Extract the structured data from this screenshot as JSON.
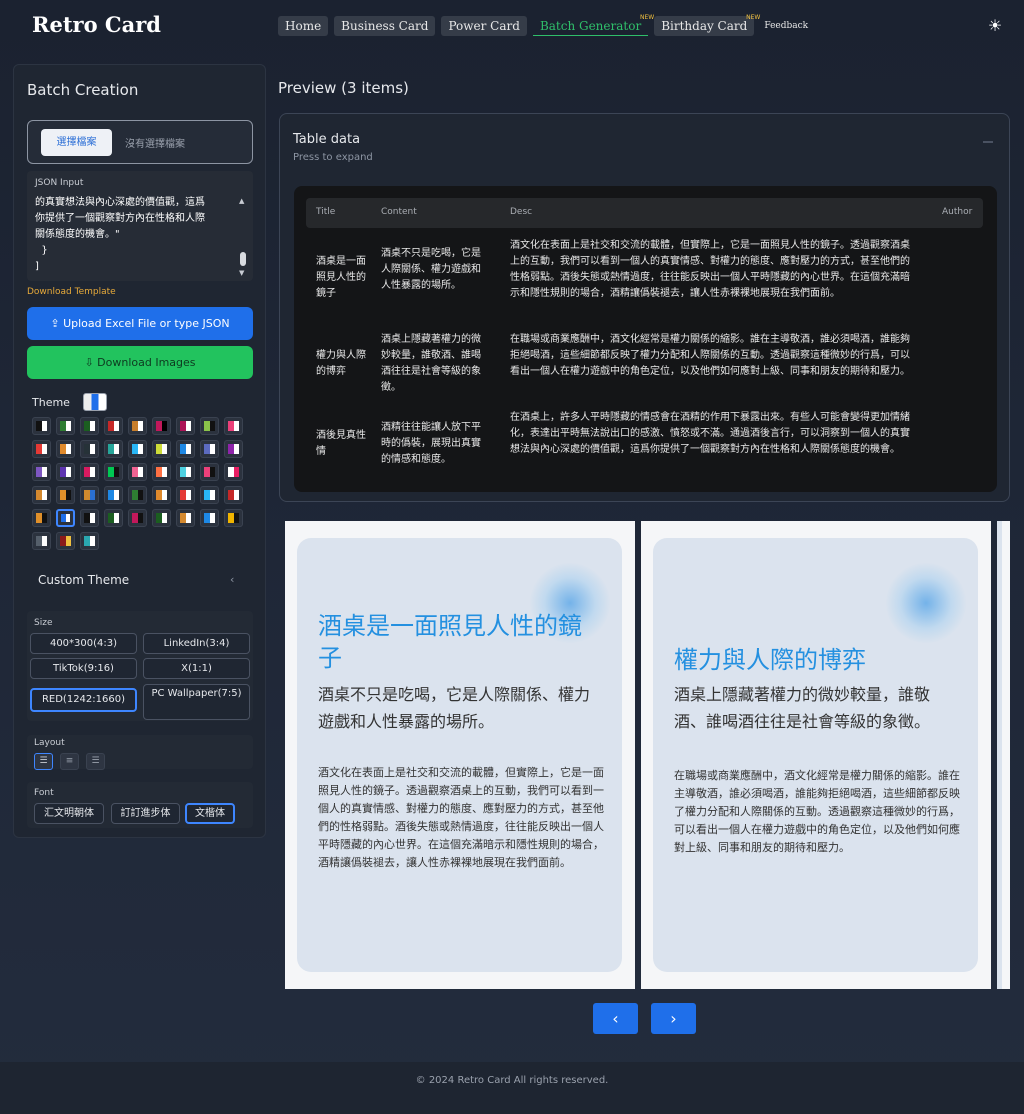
{
  "header": {
    "logo": "Retro Card",
    "nav": [
      {
        "label": "Home"
      },
      {
        "label": "Business Card"
      },
      {
        "label": "Power Card"
      },
      {
        "label": "Batch Generator",
        "badge": "NEW"
      },
      {
        "label": "Birthday Card",
        "badge": "NEW"
      },
      {
        "label": "Feedback"
      }
    ],
    "theme_toggle_icon": "sun-icon"
  },
  "sidebar": {
    "title": "Batch Creation",
    "file_button": "選擇檔案",
    "file_status": "沒有選擇檔案",
    "json_label": "JSON Input",
    "json_text": "的真實想法與內心深處的價值觀，這爲\n你提供了一個觀察對方內在性格和人際\n關係態度的機會。\"\n  }\n]",
    "download_template": "Download Template",
    "upload_button": "Upload Excel File or type JSON",
    "download_button": "Download Images",
    "theme_label": "Theme",
    "custom_theme": "Custom Theme",
    "size_label": "Size",
    "sizes": [
      "400*300(4:3)",
      "LinkedIn(3:4)",
      "TikTok(9:16)",
      "X(1:1)",
      "RED(1242:1660)",
      "PC Wallpaper(7:5)"
    ],
    "selected_size": "RED(1242:1660)",
    "layout_label": "Layout",
    "layouts": [
      "align-left-icon",
      "align-center-icon",
      "align-right-icon"
    ],
    "font_label": "Font",
    "fonts": [
      "汇文明朝体",
      "訂訂進步体",
      "文楷体"
    ],
    "selected_font": "文楷体",
    "theme_swatches": [
      [
        "#111111",
        "#ffffff"
      ],
      [
        "#2e7d32",
        "#ffffff"
      ],
      [
        "#1b5e20",
        "#ffffff"
      ],
      [
        "#c62828",
        "#ffffff"
      ],
      [
        "#c77d2a",
        "#ffffff"
      ],
      [
        "#c2185b",
        "#000000"
      ],
      [
        "#ad1457",
        "#ffffff"
      ],
      [
        "#8bc34a",
        "#111111"
      ],
      [
        "#ec407a",
        "#ffffff"
      ],
      [
        "#e53935",
        "#ffffff"
      ],
      [
        "#e08a2c",
        "#ffffff"
      ],
      [
        "#263238",
        "#ffffff"
      ],
      [
        "#26a69a",
        "#ffffff"
      ],
      [
        "#29b6f6",
        "#ffffff"
      ],
      [
        "#cddc39",
        "#ffffff"
      ],
      [
        "#1e88e5",
        "#ffffff"
      ],
      [
        "#5c6bc0",
        "#ffffff"
      ],
      [
        "#8e24aa",
        "#ffffff"
      ],
      [
        "#7e57c2",
        "#ffffff"
      ],
      [
        "#5e35b1",
        "#ffffff"
      ],
      [
        "#d81b60",
        "#ffffff"
      ],
      [
        "#00c853",
        "#111111"
      ],
      [
        "#f06292",
        "#ffffff"
      ],
      [
        "#ff7043",
        "#ffffff"
      ],
      [
        "#4dd0e1",
        "#ffffff"
      ],
      [
        "#ec407a",
        "#111111"
      ],
      [
        "#ffffff",
        "#e91e63"
      ],
      [
        "#d4892f",
        "#ffffff"
      ],
      [
        "#e0902a",
        "#111111"
      ],
      [
        "#cf8a2e",
        "#2a6fd0"
      ],
      [
        "#1e88e5",
        "#ffffff"
      ],
      [
        "#2e7d32",
        "#111111"
      ],
      [
        "#e08a2c",
        "#ffffff"
      ],
      [
        "#e53935",
        "#ffffff"
      ],
      [
        "#29b6f6",
        "#ffffff"
      ],
      [
        "#c62828",
        "#ffffff"
      ],
      [
        "#e0902a",
        "#111111"
      ],
      [
        "#1f6fea",
        "#ffffff"
      ],
      [
        "#111111",
        "#ffffff"
      ],
      [
        "#1b5e20",
        "#ffffff"
      ],
      [
        "#c2185b",
        "#111111"
      ],
      [
        "#1b5e20",
        "#ffffff"
      ],
      [
        "#d4892f",
        "#ffffff"
      ],
      [
        "#1e88e5",
        "#ffffff"
      ],
      [
        "#f0b400",
        "#111111"
      ],
      [
        "#555f6b",
        "#ffffff"
      ],
      [
        "#8b1a1a",
        "#f0c040"
      ],
      [
        "#2aa7b0",
        "#ffffff"
      ]
    ]
  },
  "preview": {
    "title": "Preview (3 items)",
    "table_title": "Table data",
    "table_subtitle": "Press to expand",
    "columns": [
      "Title",
      "Content",
      "Desc",
      "Author"
    ],
    "rows": [
      {
        "title": "酒桌是一面照見人性的鏡子",
        "content": "酒桌不只是吃喝，它是人際關係、權力遊戲和人性暴露的場所。",
        "desc": "酒文化在表面上是社交和交流的載體，但實際上，它是一面照見人性的鏡子。透過觀察酒桌上的互動，我們可以看到一個人的真實情感、對權力的態度、應對壓力的方式，甚至他們的性格弱點。酒後失態或熱情過度，往往能反映出一個人平時隱藏的內心世界。在這個充滿暗示和隱性規則的場合，酒精讓僞裝褪去，讓人性赤裸裸地展現在我們面前。",
        "author": ""
      },
      {
        "title": "權力與人際的博弈",
        "content": "酒桌上隱藏著權力的微妙較量，誰敬酒、誰喝酒往往是社會等級的象徵。",
        "desc": "在職場或商業應酬中，酒文化經常是權力關係的縮影。誰在主導敬酒，誰必須喝酒，誰能夠拒絕喝酒，這些細節都反映了權力分配和人際關係的互動。透過觀察這種微妙的行爲，可以看出一個人在權力遊戲中的角色定位，以及他們如何應對上級、同事和朋友的期待和壓力。",
        "author": ""
      },
      {
        "title": "酒後見真性情",
        "content": "酒精往往能讓人放下平時的僞裝，展現出真實的情感和態度。",
        "desc": "在酒桌上，許多人平時隱藏的情感會在酒精的作用下暴露出來。有些人可能會變得更加情緒化，表達出平時無法說出口的感激、憤怒或不滿。通過酒後言行，可以洞察到一個人的真實想法與內心深處的價值觀，這爲你提供了一個觀察對方內在性格和人際關係態度的機會。",
        "author": ""
      }
    ]
  },
  "cards": [
    {
      "title": "酒桌是一面照見人性的鏡子",
      "content": "酒桌不只是吃喝，它是人際關係、權力遊戲和人性暴露的場所。",
      "desc": "酒文化在表面上是社交和交流的載體，但實際上，它是一面照見人性的鏡子。透過觀察酒桌上的互動，我們可以看到一個人的真實情感、對權力的態度、應對壓力的方式，甚至他們的性格弱點。酒後失態或熱情過度，往往能反映出一個人平時隱藏的內心世界。在這個充滿暗示和隱性規則的場合，酒精讓僞裝褪去，讓人性赤裸裸地展現在我們面前。"
    },
    {
      "title": "權力與人際的博弈",
      "content": "酒桌上隱藏著權力的微妙較量，誰敬酒、誰喝酒往往是社會等級的象徵。",
      "desc": "在職場或商業應酬中，酒文化經常是權力關係的縮影。誰在主導敬酒，誰必須喝酒，誰能夠拒絕喝酒，這些細節都反映了權力分配和人際關係的互動。透過觀察這種微妙的行爲，可以看出一個人在權力遊戲中的角色定位，以及他們如何應對上級、同事和朋友的期待和壓力。"
    }
  ],
  "carousel": {
    "prev_icon": "chevron-left-icon",
    "next_icon": "chevron-right-icon"
  },
  "footer": {
    "text": "© 2024 Retro Card All rights reserved."
  },
  "colors": {
    "accent_blue": "#1f6fea",
    "accent_green": "#22c35e",
    "card_title": "#2490e0",
    "background": "#1b2230"
  }
}
